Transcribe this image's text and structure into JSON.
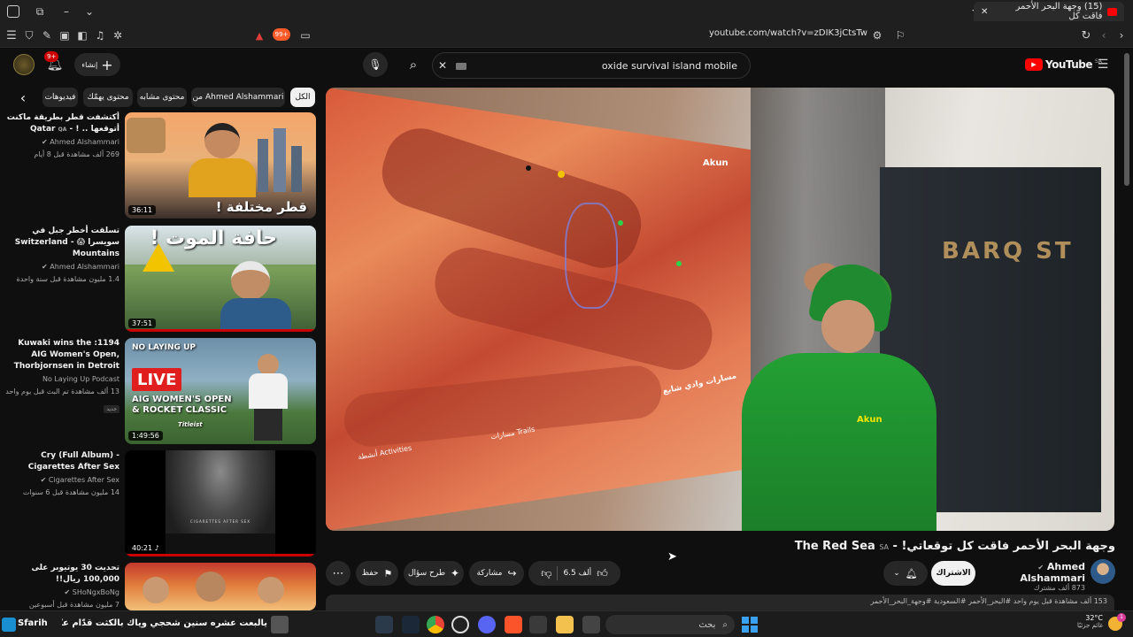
{
  "browser": {
    "tab_title": "(15) وجهة البحر الأحمر فاقت كل",
    "url": "youtube.com/watch?v=zDIK3jCtsTw",
    "badge_count": "99+"
  },
  "header": {
    "logo_text": "YouTube",
    "logo_region": "SA",
    "search_value": "oxide survival island mobile",
    "create_label": "إنشاء",
    "notif_count": "9+"
  },
  "chips": [
    "الكل",
    "من Ahmed Alshammari",
    "محتوى مشابه",
    "محتوى يهمّك",
    "فيديوهات"
  ],
  "recommendations": [
    {
      "title": "أكتشفت قطر بطريقة ماكنت أتوقعها .. ! - Qatar",
      "region": "QA",
      "channel": "Ahmed Alshammari",
      "meta": "269 ألف مشاهدة قبل 8 أيام",
      "duration": "36:11",
      "thumb_text": "قطر مختلفة !"
    },
    {
      "title": "تسلقت أخطر جبل في سويسرا 😱 - Switzerland Mountains",
      "region": "CH",
      "channel": "Ahmed Alshammari",
      "meta": "1.4 مليون مشاهدة قبل سنة واحدة",
      "duration": "37:51",
      "thumb_text": "حافة الموت !"
    },
    {
      "title": "1194: Kuwaki wins the AIG Women's Open, Thorbjornsen in Detroit",
      "channel": "No Laying Up Podcast",
      "meta": "13 ألف مشاهدة تم البث قبل يوم واحد",
      "badge": "جديد",
      "duration": "1:49:56",
      "thumb_line1": "NO LAYING UP",
      "thumb_live": "LIVE",
      "thumb_line2": "AIG WOMEN'S OPEN",
      "thumb_line3": "& ROCKET CLASSIC",
      "thumb_sponsor": "Titleist"
    },
    {
      "title": "Cry (Full Album) - Cigarettes After Sex",
      "channel": "Cigarettes After Sex",
      "meta": "14 مليون مشاهدة قبل 6 سنوات",
      "duration": "40:21",
      "thumb_text": "CIGARETTES AFTER SEX"
    },
    {
      "title": "تحديت 30 يوتيوبر على 100,000 ريال!!",
      "channel": "SHoNgxBoNg",
      "meta": "7 مليون مشاهدة قبل أسبوعين"
    }
  ],
  "video": {
    "title": "وجهة البحر الأحمر فاقت كل توقعاتي! - The Red Sea",
    "region": "SA",
    "map_brand": "Akun",
    "map_heading": "مسارات وادي شايع",
    "map_trails": "مسارات Trails",
    "map_activities": "أنشطة Activities",
    "wall_sign": "BARQ ST",
    "shirt_logo": "Akun",
    "channel": "Ahmed Alshammari",
    "subs": "873 ألف مشترك",
    "subscribe_label": "الاشتراك",
    "likes": "6.5 ألف",
    "share_label": "مشاركة",
    "ask_label": "طرح سؤال",
    "save_label": "حفظ",
    "desc_meta": "153 ألف مشاهدة قبل يوم واحد  #البحر_الأحمر #السعودية #وجهة_البحر_الأحمر"
  },
  "taskbar": {
    "news_text": "يالبعت عشره سنين شحجي وياك بالكثت قدّام عيّني",
    "news_brand": "Sfarih",
    "search_placeholder": "بحث",
    "weather_temp": "32°C",
    "weather_desc": "غائم جزئيًا",
    "notif": "1"
  }
}
